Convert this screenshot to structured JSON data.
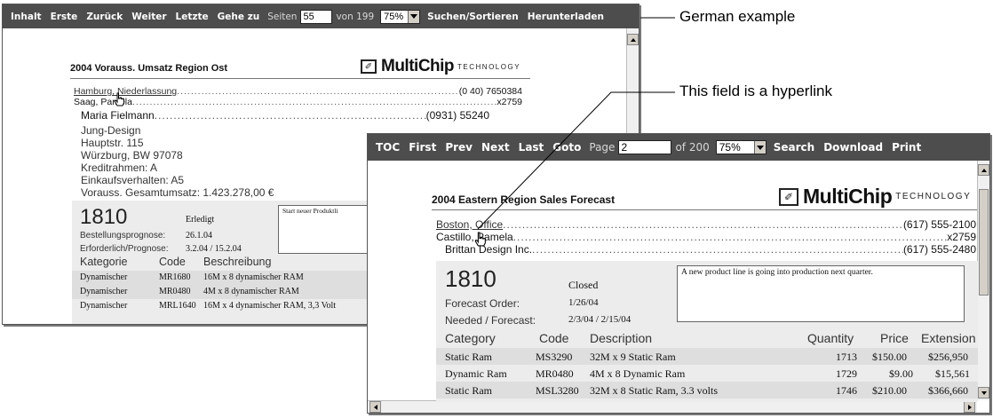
{
  "annotations": {
    "german": "German example",
    "hyperlink": "This field is a hyperlink"
  },
  "german": {
    "toolbar": {
      "toc": "Inhalt",
      "first": "Erste",
      "prev": "Zurück",
      "next": "Weiter",
      "last": "Letzte",
      "goto": "Gehe zu",
      "page_label": "Seiten",
      "page_value": "55",
      "of": "von 199",
      "zoom": "75%",
      "search": "Suchen/Sortieren",
      "download": "Herunterladen"
    },
    "title": "2004 Vorauss. Umsatz Region Ost",
    "logo": {
      "word": "MultiChip",
      "tag": "TECHNOLOGY"
    },
    "office_link": "Hamburg, Niederlassung",
    "office_phone": "(0 40) 7650384",
    "rep_name": "Saag, Pamela",
    "rep_ext": "x2759",
    "customer_name": "Maria Fielmann",
    "customer_phone": "(0931) 55240",
    "address": [
      "Jung-Design",
      "Hauptstr. 115",
      "Würzburg, BW  97078"
    ],
    "credit": "Kreditrahmen:   A",
    "buying": "Einkaufsverhalten:    A5",
    "total": "Vorauss. Gesamtumsatz:   1.423.278,00 €",
    "forecast_number": "1810",
    "status": "Erledigt",
    "order_label": "Bestellungsprognose:",
    "order_date": "26.1.04",
    "needed_label": "Erforderlich/Prognose:",
    "needed_dates": "3.2.04   / 15.2.04",
    "note": "Start neuer Produktli",
    "columns": {
      "category": "Kategorie",
      "code": "Code",
      "description": "Beschreibung"
    },
    "rows": [
      {
        "category": "Dynamischer",
        "code": "MR1680",
        "description": "16M x 8 dynamischer RAM"
      },
      {
        "category": "Dynamischer",
        "code": "MR0480",
        "description": "4M x 8 dynamischer RAM"
      },
      {
        "category": "Dynamischer",
        "code": "MRL1640",
        "description": "16M x 4 dynamischer RAM, 3,3 Volt"
      }
    ]
  },
  "english": {
    "toolbar": {
      "toc": "TOC",
      "first": "First",
      "prev": "Prev",
      "next": "Next",
      "last": "Last",
      "goto": "Goto",
      "page_label": "Page",
      "page_value": "2",
      "of": "of 200",
      "zoom": "75%",
      "search": "Search",
      "download": "Download",
      "print": "Print"
    },
    "title": "2004 Eastern Region Sales Forecast",
    "logo": {
      "word": "MultiChip",
      "tag": "TECHNOLOGY"
    },
    "office_link": "Boston, Office",
    "office_phone": "(617) 555-2100",
    "rep_name": "Castillo, Pamela",
    "rep_ext": "x2759",
    "customer_name": "Brittan Design Inc.",
    "customer_phone": "(617) 555-2480",
    "forecast_number": "1810",
    "status": "Closed",
    "order_label": "Forecast Order:",
    "order_date": "1/26/04",
    "needed_label": "Needed / Forecast:",
    "needed_dates": "2/3/04    / 2/15/04",
    "note": "A new product line is going into production next quarter.",
    "columns": {
      "category": "Category",
      "code": "Code",
      "description": "Description",
      "quantity": "Quantity",
      "price": "Price",
      "extension": "Extension"
    },
    "rows": [
      {
        "category": "Static Ram",
        "code": "MS3290",
        "description": "32M x 9 Static Ram",
        "quantity": "1713",
        "price": "$150.00",
        "extension": "$256,950"
      },
      {
        "category": "Dynamic Ram",
        "code": "MR0480",
        "description": "4M x 8 Dynamic Ram",
        "quantity": "1729",
        "price": "$9.00",
        "extension": "$15,561"
      },
      {
        "category": "Static Ram",
        "code": "MSL3280",
        "description": "32M x 8 Static Ram, 3.3 volts",
        "quantity": "1746",
        "price": "$210.00",
        "extension": "$366,660"
      }
    ]
  },
  "icons": {
    "logo": "multichip-logo-icon",
    "cursor": "hand-pointer-icon"
  },
  "colors": {
    "toolbar_bg": "#4d4d4d",
    "band_bg": "#ececec",
    "row_bg": "#dedede"
  }
}
